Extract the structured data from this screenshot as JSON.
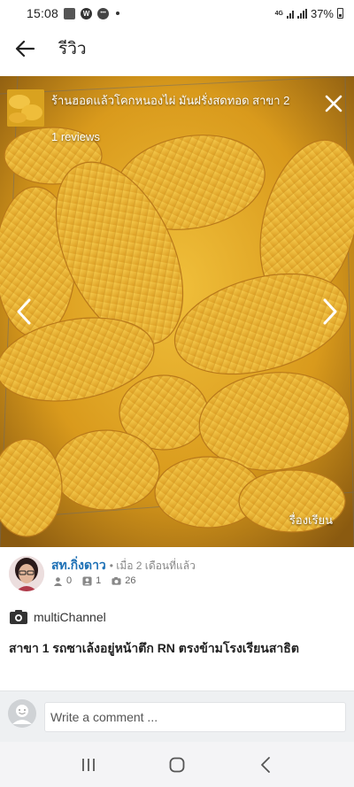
{
  "status_bar": {
    "time": "15:08",
    "network": "4G",
    "battery": "37%"
  },
  "app_bar": {
    "title": "รีวิว"
  },
  "photo": {
    "title": "ร้านฮอดแล้วโคกหนองไผ่ มันฝรั่งสดทอด สาขา 2",
    "reviews": "1 reviews",
    "caption": "รื่องเรียน"
  },
  "reviewer": {
    "name": "สท.กิ่งดาว",
    "time": "เมื่อ 2 เดือนที่แล้ว",
    "stats": {
      "reviews": "0",
      "followers": "1",
      "photos": "26"
    }
  },
  "channel": {
    "label": "multiChannel"
  },
  "review": {
    "text": "สาขา 1 รถซาเล้งอยู่หน้าตึก RN ตรงข้ามโรงเรียนสาธิต"
  },
  "comment": {
    "placeholder": "Write a comment ..."
  },
  "colors": {
    "accent": "#1b6fb5",
    "fries": "#e8a821"
  }
}
